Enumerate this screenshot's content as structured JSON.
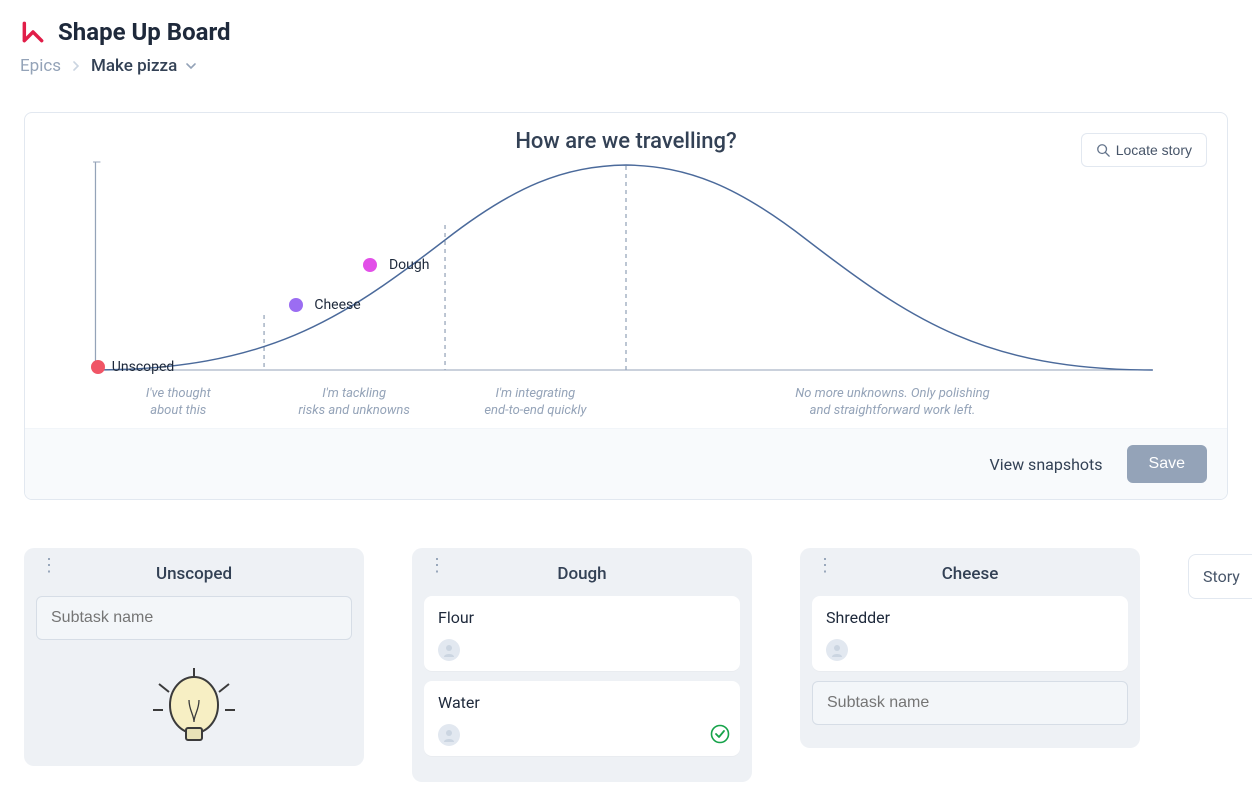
{
  "header": {
    "title": "Shape Up Board",
    "breadcrumb_root": "Epics",
    "breadcrumb_current": "Make pizza"
  },
  "chart": {
    "title": "How are we travelling?",
    "locate_label": "Locate story",
    "view_snapshots_label": "View snapshots",
    "save_label": "Save",
    "phases": [
      "I've thought\nabout this",
      "I'm tackling\nrisks and unknowns",
      "I'm integrating\nend-to-end quickly",
      "No more unknowns. Only polishing\nand straightforward work left."
    ]
  },
  "chart_data": {
    "type": "hill",
    "xlabel": "",
    "ylabel": "",
    "x_range_percent": [
      0,
      100
    ],
    "phase_boundaries_percent": [
      16,
      33,
      50
    ],
    "series": [
      {
        "name": "Unscoped",
        "x_percent": 0,
        "color": "#f05566"
      },
      {
        "name": "Cheese",
        "x_percent": 19,
        "color": "#9b6df2"
      },
      {
        "name": "Dough",
        "x_percent": 26,
        "color": "#e24fe8"
      }
    ]
  },
  "columns": [
    {
      "title": "Unscoped",
      "input_placeholder": "Subtask name",
      "cards": [],
      "show_lightbulb": true
    },
    {
      "title": "Dough",
      "input_placeholder": "Subtask name",
      "cards": [
        {
          "title": "Flour",
          "done": false
        },
        {
          "title": "Water",
          "done": true
        }
      ],
      "show_input_after": false
    },
    {
      "title": "Cheese",
      "input_placeholder": "Subtask name",
      "cards": [
        {
          "title": "Shredder",
          "done": false
        }
      ],
      "show_input_after": true
    }
  ],
  "story_pill_label": "Story"
}
